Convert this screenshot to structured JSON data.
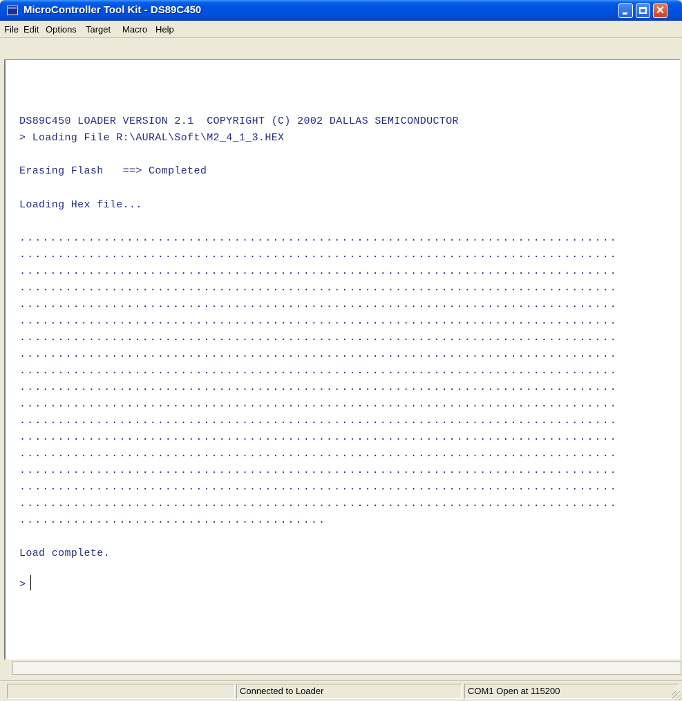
{
  "window": {
    "title": "MicroController Tool Kit - DS89C450"
  },
  "icons": {
    "app": "app-icon",
    "minimize": "minimize-icon",
    "maximize": "maximize-icon",
    "close": "close-icon"
  },
  "colors": {
    "titlebar": "#0054e3",
    "terminal_text": "#232c82",
    "close_button": "#c8421e"
  },
  "menu": {
    "items": [
      "File",
      "Edit",
      "Options",
      "Target",
      "Macro",
      "Help"
    ]
  },
  "terminal": {
    "lines": [
      "DS89C450 LOADER VERSION 2.1  COPYRIGHT (C) 2002 DALLAS SEMICONDUCTOR",
      "> Loading File R:\\AURAL\\Soft\\M2_4_1_3.HEX",
      "Erasing Flash   ==> Completed",
      "Loading Hex file...",
      "Load complete.",
      "> "
    ],
    "progress_lines": [
      "..............................................................................",
      "..............................................................................",
      "..............................................................................",
      "..............................................................................",
      "..............................................................................",
      "..............................................................................",
      "..............................................................................",
      "..............................................................................",
      "..............................................................................",
      "..............................................................................",
      "..............................................................................",
      "..............................................................................",
      "..............................................................................",
      "..............................................................................",
      "..............................................................................",
      "..............................................................................",
      "..............................................................................",
      "........................................"
    ]
  },
  "status": {
    "pane1": "",
    "pane2": "Connected to Loader",
    "pane3": "COM1 Open at 115200"
  }
}
